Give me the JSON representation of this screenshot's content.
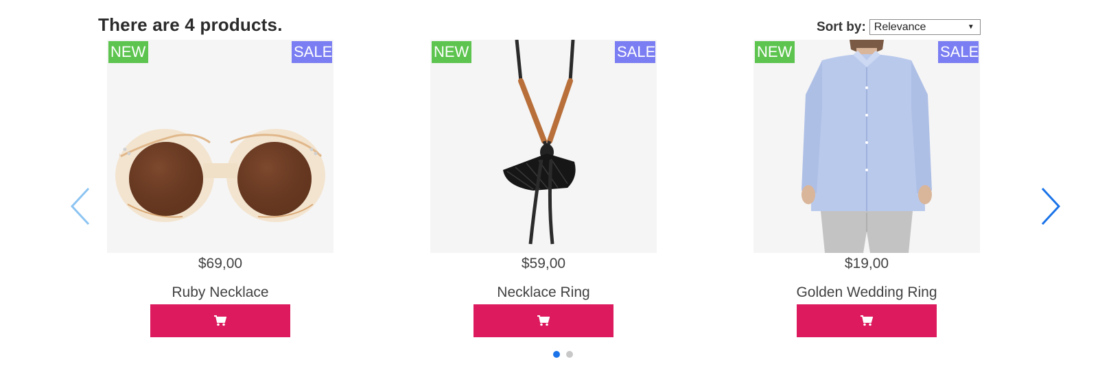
{
  "listing": {
    "count_text": "There are 4 products."
  },
  "sort": {
    "label": "Sort by:",
    "selected": "Relevance"
  },
  "products": [
    {
      "name": "Ruby Necklace",
      "price": "$69,00",
      "badge_new": "NEW",
      "badge_sale": "SALE",
      "image": "sunglasses"
    },
    {
      "name": "Necklace Ring",
      "price": "$59,00",
      "badge_new": "NEW",
      "badge_sale": "SALE",
      "image": "tassel-necklace"
    },
    {
      "name": "Golden Wedding Ring",
      "price": "$19,00",
      "badge_new": "NEW",
      "badge_sale": "SALE",
      "image": "man-in-blue-shirt"
    }
  ],
  "carousel": {
    "pages": 2,
    "active_page": 1
  },
  "icons": {
    "prev": "chevron-left-icon",
    "next": "chevron-right-icon",
    "cart": "cart-icon"
  },
  "colors": {
    "new_badge": "#5dc44f",
    "sale_badge": "#7b7ef2",
    "cart_button": "#dc1a5d",
    "active_dot": "#1a73e8"
  }
}
